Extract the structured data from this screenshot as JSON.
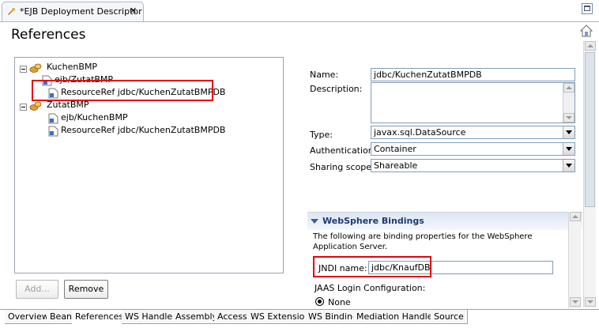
{
  "editor": {
    "tab_title": "*EJB Deployment Descriptor",
    "close_glyph": "✕"
  },
  "page": {
    "title": "References"
  },
  "tree": {
    "items": [
      {
        "label": "KuchenBMP",
        "icon": "bean-icon",
        "kind": "bean"
      },
      {
        "label": "ejb/ZutatBMP",
        "icon": "ejb-ref-icon",
        "kind": "ref"
      },
      {
        "label": "ResourceRef jdbc/KuchenZutatBMPDB",
        "icon": "resource-ref-icon",
        "kind": "ref",
        "selected": true
      },
      {
        "label": "ZutatBMP",
        "icon": "bean-icon",
        "kind": "bean"
      },
      {
        "label": "ejb/KuchenBMP",
        "icon": "ejb-ref-icon",
        "kind": "ref"
      },
      {
        "label": "ResourceRef jdbc/KuchenZutatBMPDB",
        "icon": "resource-ref-icon",
        "kind": "ref"
      }
    ]
  },
  "buttons": {
    "add": "Add...",
    "remove": "Remove"
  },
  "form": {
    "name_label": "Name:",
    "name_value": "jdbc/KuchenZutatBMPDB",
    "description_label": "Description:",
    "description_value": "",
    "type_label": "Type:",
    "type_value": "javax.sql.DataSource",
    "auth_label": "Authentication:",
    "auth_value": "Container",
    "sharing_label": "Sharing scope:",
    "sharing_value": "Shareable"
  },
  "bindings": {
    "title": "WebSphere Bindings",
    "description": "The following are binding properties for the WebSphere Application Server.",
    "jndi_label": "JNDI name:",
    "jndi_value": "jdbc/KnaufDB",
    "jaas_label": "JAAS Login Configuration:",
    "jaas_option": "None"
  },
  "bottom_tabs": [
    "Overview",
    "Bean",
    "References",
    "WS Handler",
    "Assembly",
    "Access",
    "WS Extension",
    "WS Binding",
    "Mediation Handlers",
    "Source"
  ],
  "active_bottom_tab": "References",
  "colors": {
    "highlight": "#e8000d",
    "section_header": "#1f3b70",
    "tab_border": "#a5b8d6"
  }
}
